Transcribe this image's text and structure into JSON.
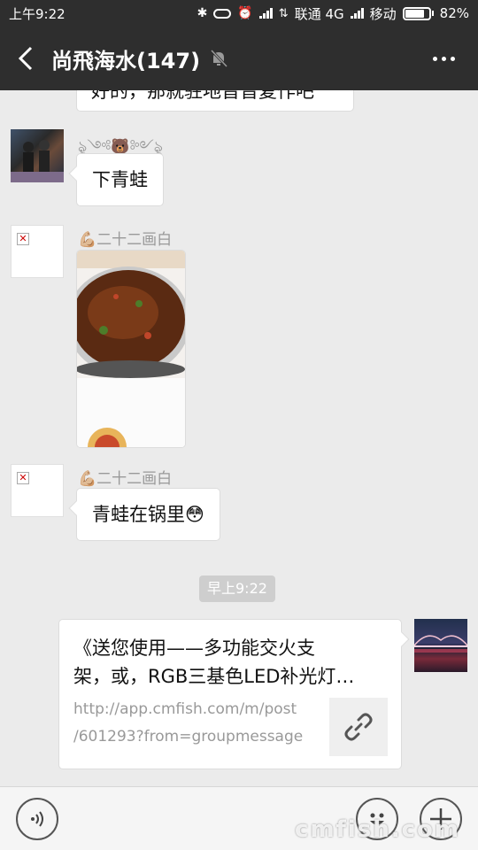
{
  "status_bar": {
    "time": "上午9:22",
    "carrier1": "联通 4G",
    "carrier2": "移动",
    "battery_percent": "82%",
    "battery_level": 0.82
  },
  "nav": {
    "title": "尚飛海水(147)"
  },
  "messages": [
    {
      "type": "text",
      "side": "left",
      "text": "好的，那就驻地晋晋复作吧"
    },
    {
      "type": "text",
      "side": "left",
      "sender": "ৡৢ༺🐻༻ৡৢ",
      "text": "下青蛙"
    },
    {
      "type": "image",
      "side": "left",
      "sender": "💪🏼二十二画白"
    },
    {
      "type": "text",
      "side": "left",
      "sender": "💪🏼二十二画白",
      "text": "青蛙在锅里😳"
    },
    {
      "type": "time",
      "text": "早上9:22"
    },
    {
      "type": "link",
      "side": "right",
      "title_line1": "《送您使用——多功能交火支",
      "title_line2": "架，或，RGB三基色LED补光灯…",
      "url_line1": "http://app.cmfish.com/m/post",
      "url_line2": "/601293?from=groupmessage"
    }
  ],
  "watermark": "cmfish.com",
  "colors": {
    "bar_bg": "#2e2e2e",
    "chat_bg": "#ebebeb",
    "bubble": "#ffffff"
  }
}
